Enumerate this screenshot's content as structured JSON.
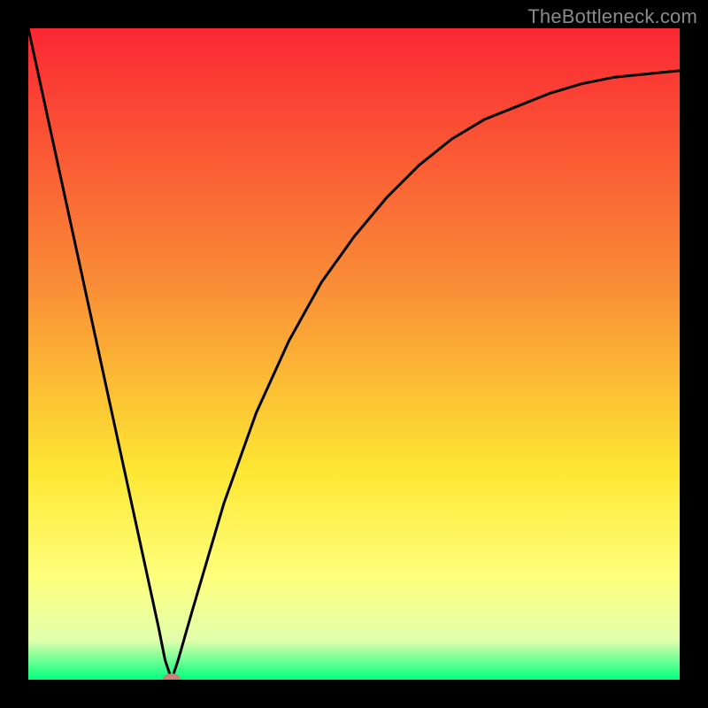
{
  "watermark": "TheBottleneck.com",
  "colors": {
    "frame": "#000000",
    "curve": "#000000",
    "marker": "#cb8276",
    "gradient_top": "#fb2733",
    "gradient_mid1": "#f98f36",
    "gradient_mid2": "#fee733",
    "gradient_mid3": "#feff7b",
    "gradient_mid4": "#e2ffad",
    "gradient_bottom": "#00ff7e"
  },
  "chart_data": {
    "type": "line",
    "title": "",
    "xlabel": "",
    "ylabel": "",
    "xlim": [
      0,
      100
    ],
    "ylim": [
      0,
      100
    ],
    "grid": false,
    "legend": false,
    "series": [
      {
        "name": "curve",
        "x": [
          0,
          5,
          10,
          15,
          20,
          21,
          22,
          23,
          25,
          30,
          35,
          40,
          45,
          50,
          55,
          60,
          65,
          70,
          75,
          80,
          85,
          90,
          95,
          100
        ],
        "y": [
          100,
          77,
          54,
          31,
          8,
          3,
          0,
          3,
          10,
          27,
          41,
          52,
          61,
          68,
          74,
          79,
          83,
          86,
          88,
          90,
          91.5,
          92.5,
          93,
          93.5
        ]
      }
    ],
    "marker": {
      "x": 22,
      "y": 0
    },
    "annotations": []
  }
}
